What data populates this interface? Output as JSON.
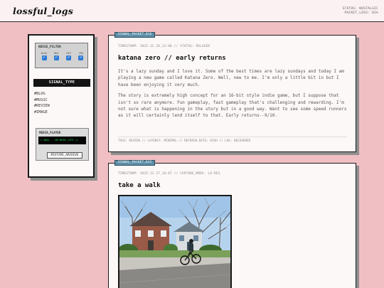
{
  "header": {
    "brand": "lossful_logs",
    "status_lines": [
      "STATUS: NOSTALGIC",
      "PACKET_LOSS: 82%"
    ]
  },
  "sidebar": {
    "noise_filter": {
      "label": "NOISE_FILTER",
      "columns": [
        {
          "label": "BLOG",
          "checked": true
        },
        {
          "label": "MUS",
          "checked": true
        },
        {
          "label": "REV",
          "checked": true
        },
        {
          "label": "IMG",
          "checked": true
        }
      ]
    },
    "signal_type": "SIGNAL_TYPE",
    "categories": [
      "#BLOG",
      "#MUSIC",
      "#REVIEW",
      "#IMAGE"
    ],
    "media_player": {
      "label": "MEDIA_PLAYER",
      "now_playing": "> NULL - IN MEGO LIFE ((",
      "button": "MIXTAPE_ARCHIVE"
    }
  },
  "posts": [
    {
      "tag": "SIGNAL_PACKET_016",
      "meta": "TIMESTAMP: 2025.12.28_12:00 // STATUS: RELAXED",
      "title": "katana zero // early returns",
      "paragraphs": [
        "It's a lazy sunday and I love it. Some of the best times are lazy sundays and today I am playing a new game called Katana Zero. Well, new to me. I'm only a little bit in but I have been enjoying it very much.",
        "The story is extremely high concept for an 16-bit style indie game, but I suppose that isn't so rare anymore. Fun gameplay, fast gameplay that's challenging and rewarding. I'm not sure what is happening in the story but in a good way. Want to see some speed runners as it will certainly lend itself to that. Early returns--9/10."
      ],
      "footer": "TAGS: REVIEW // LATENCY: MINIMAL // REFRESH_RATE: HIGH // LOG: RECOVERED"
    },
    {
      "tag": "SIGNAL_PACKET_015",
      "meta": "TIMESTAMP: 2025.12.27_16:07 // CAPTURE_MODE: LO-RES",
      "title": "take a walk"
    }
  ],
  "colors": {
    "background": "#f0bfc4",
    "tag_blue": "#5e8fa8",
    "check_blue": "#2e7bd6",
    "player_green": "#20d24a"
  }
}
